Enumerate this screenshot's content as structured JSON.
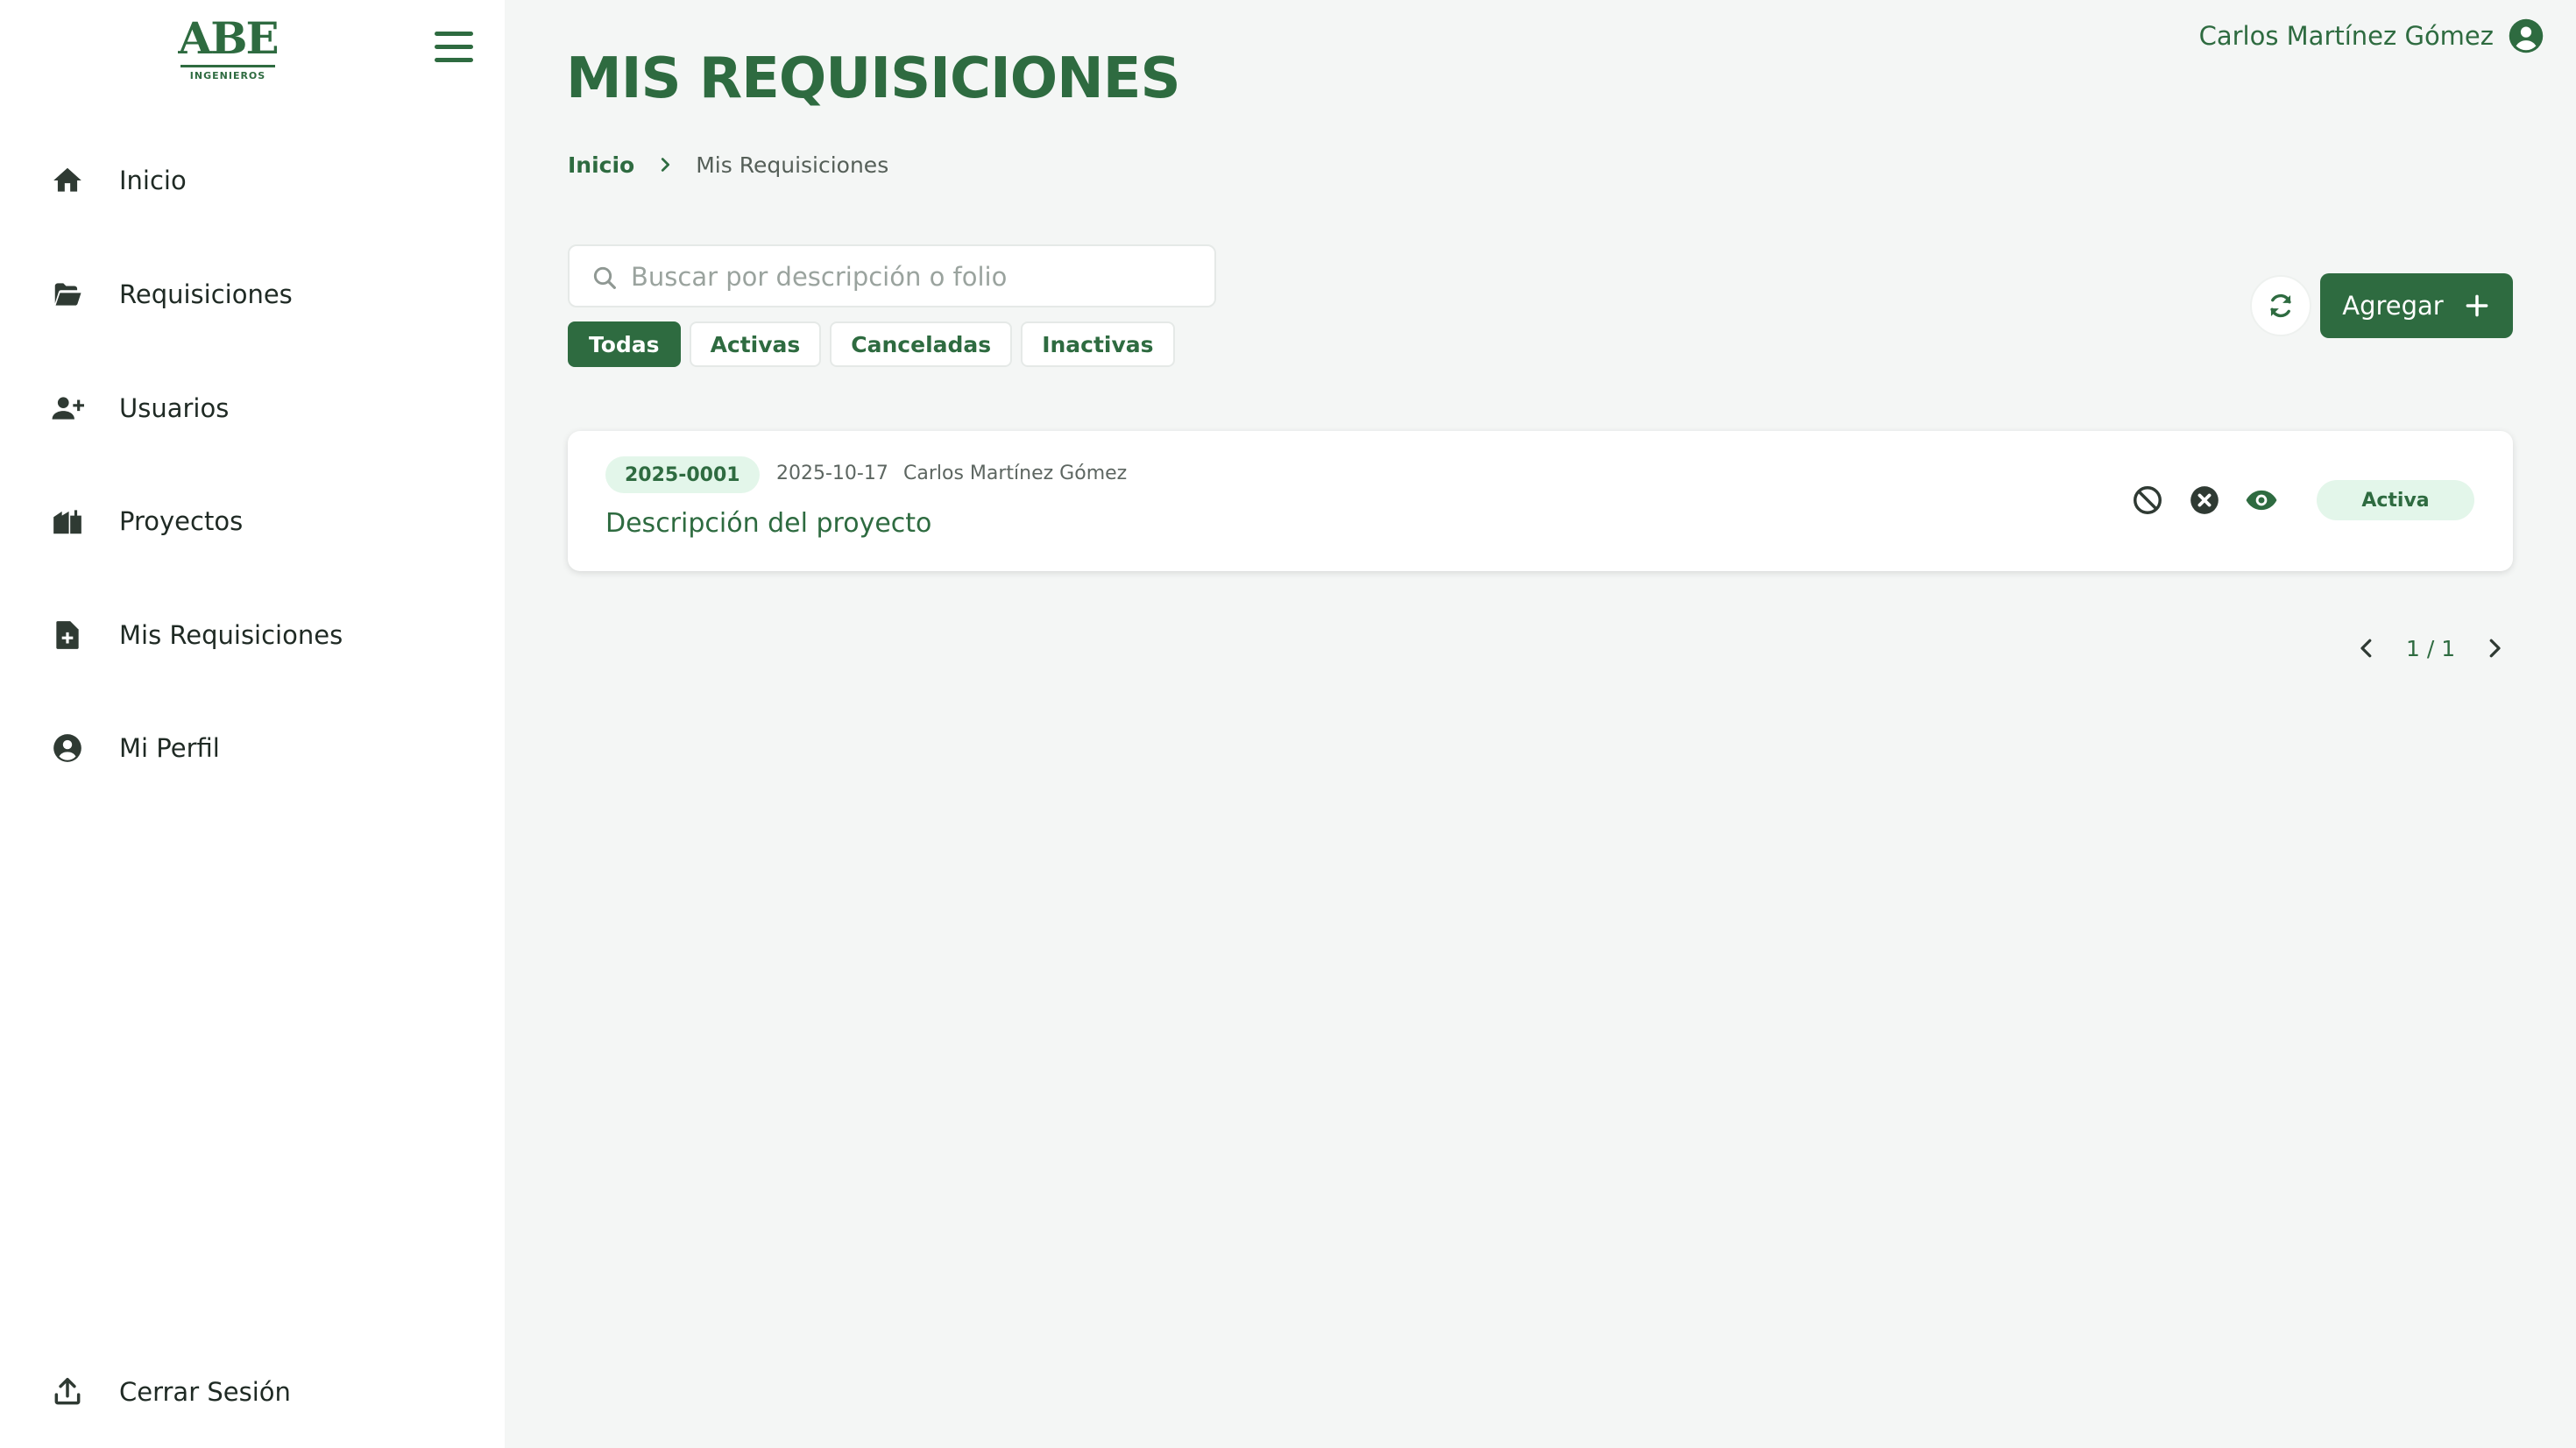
{
  "brand": {
    "logo_text": "ABE",
    "logo_subtext": "INGENIEROS"
  },
  "sidebar": {
    "items": [
      {
        "label": "Inicio",
        "icon": "home-icon"
      },
      {
        "label": "Requisiciones",
        "icon": "folder-open-icon"
      },
      {
        "label": "Usuarios",
        "icon": "user-plus-icon"
      },
      {
        "label": "Proyectos",
        "icon": "city-icon"
      },
      {
        "label": "Mis Requisiciones",
        "icon": "file-plus-icon"
      },
      {
        "label": "Mi Perfil",
        "icon": "user-circle-icon"
      }
    ],
    "logout": {
      "label": "Cerrar Sesión",
      "icon": "upload-icon"
    }
  },
  "header": {
    "user_name": "Carlos Martínez Gómez",
    "page_title": "MIS REQUISICIONES"
  },
  "breadcrumb": {
    "home": "Inicio",
    "current": "Mis Requisiciones"
  },
  "search": {
    "placeholder": "Buscar por descripción o folio",
    "value": ""
  },
  "filters": [
    {
      "label": "Todas",
      "active": true
    },
    {
      "label": "Activas",
      "active": false
    },
    {
      "label": "Canceladas",
      "active": false
    },
    {
      "label": "Inactivas",
      "active": false
    }
  ],
  "toolbar": {
    "add_label": "Agregar"
  },
  "requisitions": [
    {
      "folio": "2025-0001",
      "date": "2025-10-17",
      "author": "Carlos Martínez Gómez",
      "description": "Descripción del proyecto",
      "status": "Activa"
    }
  ],
  "pagination": {
    "label": "1 / 1"
  },
  "colors": {
    "accent": "#2e6b40",
    "badge_bg": "#e3f6ea",
    "background": "#f4f6f5"
  }
}
